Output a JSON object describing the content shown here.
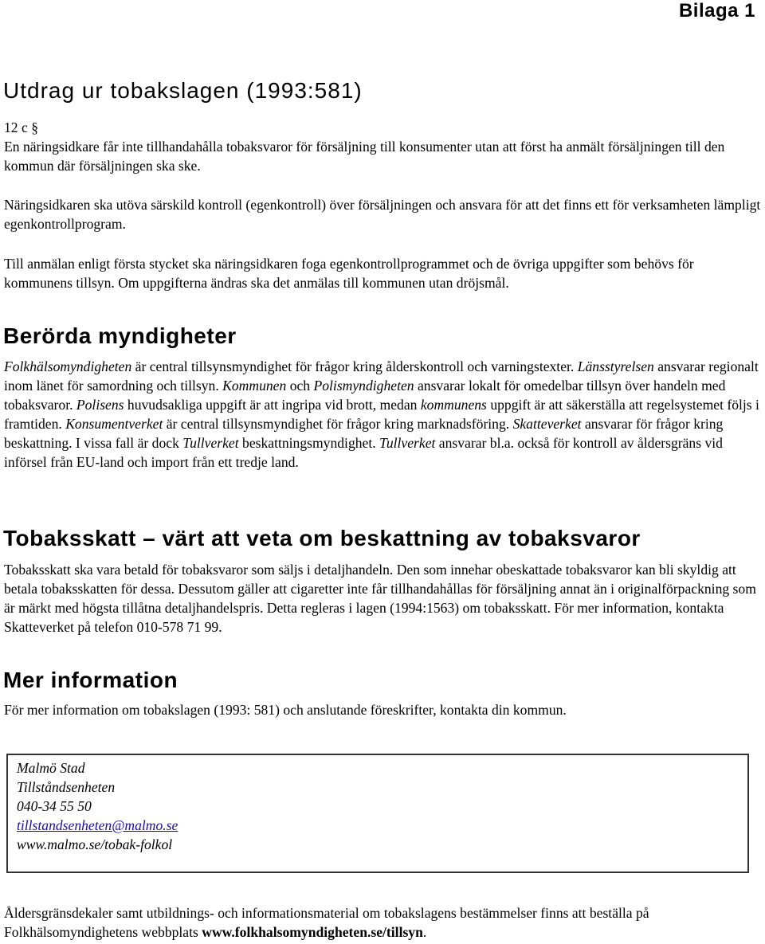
{
  "header": {
    "attachment_label": "Bilaga 1"
  },
  "section1": {
    "title": "Utdrag ur tobakslagen (1993:581)",
    "paragraph_ref": "12 c §",
    "p1": "En näringsidkare får inte tillhandahålla tobaksvaror för försäljning till konsumenter utan att först ha anmält försäljningen till den kommun där försäljningen ska ske.",
    "p2": "Näringsidkaren ska utöva särskild kontroll (egenkontroll) över försäljningen och ansvara för att det finns ett för verksamheten lämpligt egenkontrollprogram.",
    "p3": "Till anmälan enligt första stycket ska näringsidkaren foga egenkontrollprogrammet och de övriga uppgifter som behövs för kommunens tillsyn. Om uppgifterna ändras ska det anmälas till kommunen utan dröjsmål."
  },
  "section2": {
    "title": "Berörda myndigheter",
    "segments": [
      {
        "text": "Folkhälsomyndigheten",
        "italic": true
      },
      {
        "text": " är central tillsynsmyndighet för frågor kring ålderskontroll och varningstexter. ",
        "italic": false
      },
      {
        "text": "Länsstyrelsen",
        "italic": true
      },
      {
        "text": " ansvarar regionalt inom länet för samordning och tillsyn. ",
        "italic": false
      },
      {
        "text": "Kommunen",
        "italic": true
      },
      {
        "text": " och ",
        "italic": false
      },
      {
        "text": "Polismyndigheten",
        "italic": true
      },
      {
        "text": " ansvarar lokalt för omedelbar tillsyn över handeln med tobaksvaror. ",
        "italic": false
      },
      {
        "text": "Polisens",
        "italic": true
      },
      {
        "text": " huvudsakliga uppgift är att ingripa vid brott, medan ",
        "italic": false
      },
      {
        "text": "kommunens",
        "italic": true
      },
      {
        "text": " uppgift är att säkerställa att regelsystemet följs i framtiden. ",
        "italic": false
      },
      {
        "text": "Konsumentverket",
        "italic": true
      },
      {
        "text": " är central tillsynsmyndighet för frågor kring marknadsföring. ",
        "italic": false
      },
      {
        "text": "Skatteverket",
        "italic": true
      },
      {
        "text": " ansvarar för frågor kring beskattning. I vissa fall är dock ",
        "italic": false
      },
      {
        "text": "Tullverket",
        "italic": true
      },
      {
        "text": " beskattningsmyndighet. ",
        "italic": false
      },
      {
        "text": "Tullverket",
        "italic": true
      },
      {
        "text": " ansvarar bl.a. också för kontroll av åldersgräns vid införsel från EU-land och import från ett tredje land.",
        "italic": false
      }
    ]
  },
  "section3": {
    "title": "Tobaksskatt – värt att veta om beskattning av tobaksvaror",
    "body": "Tobaksskatt ska vara betald för tobaksvaror som säljs i detaljhandeln. Den som innehar obeskattade tobaksvaror kan bli skyldig att betala tobaksskatten för dessa. Dessutom gäller att cigaretter inte får tillhandahållas för försäljning annat än i originalförpackning som är märkt med högsta tillåtna detaljhandelspris. Detta regleras i lagen (1994:1563) om tobaksskatt.  För mer information, kontakta Skatteverket på telefon 010-578 71 99."
  },
  "section4": {
    "title": "Mer information",
    "body": "För mer information om tobakslagen (1993: 581) och anslutande föreskrifter, kontakta din kommun."
  },
  "contact": {
    "organization": "Malmö Stad",
    "unit": "Tillståndsenheten",
    "phone": "040-34 55 50",
    "email": "tillstandsenheten@malmo.se",
    "website": "www.malmo.se/tobak-folkol",
    "link_color": "#1a0dab"
  },
  "footer": {
    "text_before": "Åldersgränsdekaler samt utbildnings- och informationsmaterial om tobakslagens bestämmelser finns att beställa på Folkhälsomyndighetens webbplats ",
    "link": "www.folkhalsomyndigheten.se/tillsyn",
    "text_after": "."
  }
}
